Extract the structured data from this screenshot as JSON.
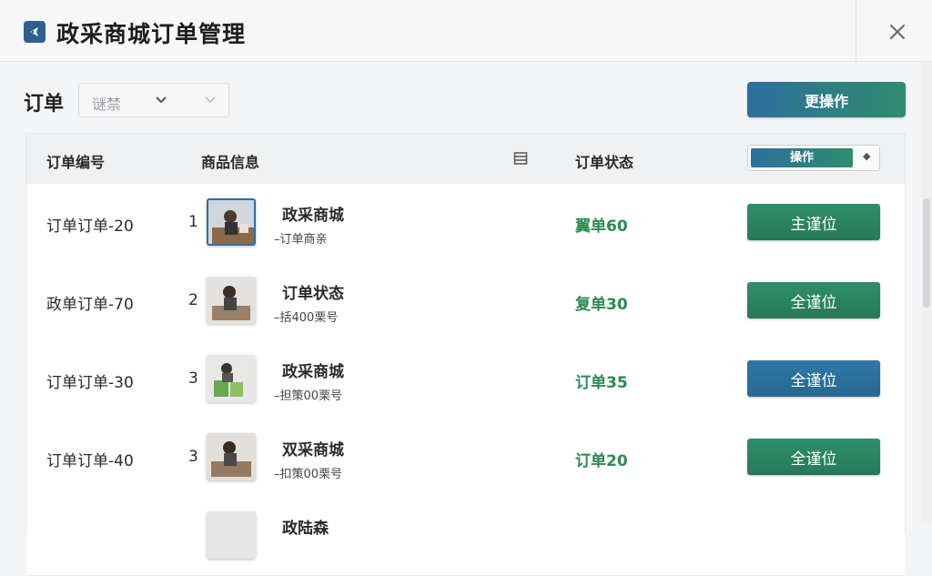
{
  "window": {
    "title": "政采商城订单管理"
  },
  "toolbar": {
    "label": "订单",
    "filter_value": "谜禁",
    "more_label": "更操作"
  },
  "table": {
    "headers": {
      "order_no": "订单编号",
      "product_info": "商品信息",
      "status": "订单状态",
      "action": "操作"
    },
    "rows": [
      {
        "order_no": "订单订单-20",
        "qty": "1",
        "name": "政采商城",
        "sub": "–订单商亲",
        "status": "翼单60",
        "button": "主谨位",
        "button_color": "green",
        "thumb": "blue"
      },
      {
        "order_no": "政单订单-70",
        "qty": "2",
        "name": "订单状态",
        "sub": "–括400栗号",
        "status": "复单30",
        "button": "全谨位",
        "button_color": "green",
        "thumb": "plain"
      },
      {
        "order_no": "订单订单-30",
        "qty": "3",
        "name": "政采商城",
        "sub": "–担策00栗号",
        "status": "订单35",
        "button": "全谨位",
        "button_color": "blue",
        "thumb": "green"
      },
      {
        "order_no": "订单订单-40",
        "qty": "3",
        "name": "双采商城",
        "sub": "–扣策00栗号",
        "status": "订单20",
        "button": "全谨位",
        "button_color": "green",
        "thumb": "plain"
      },
      {
        "order_no": "",
        "qty": "",
        "name": "政陆森",
        "sub": "",
        "status": "",
        "button": "",
        "button_color": "",
        "thumb": "plain"
      }
    ]
  },
  "colors": {
    "accent_blue": "#2e6f9e",
    "accent_green": "#2e8d6e",
    "status_green": "#2c8a4e"
  }
}
